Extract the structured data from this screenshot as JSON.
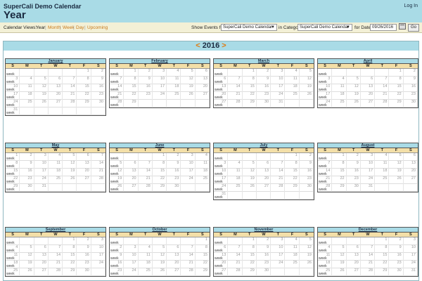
{
  "header": {
    "app_title": "SuperCali Demo Calendar",
    "page_title": "Year",
    "login": "Log In"
  },
  "toolbar": {
    "views_label": "Calendar Views:",
    "views": [
      "Year",
      "Month",
      "Week",
      "Day",
      "Upcoming"
    ],
    "show_events_label": "Show Events for:",
    "calendar_select": "SuperCali Demo Calendar",
    "category_label": "in Category:",
    "category_select": "SuperCali Demo Calendar",
    "date_label": "for Date:",
    "date_value": "09/26/2016",
    "go_label": "Go"
  },
  "year_nav": {
    "prev": "<",
    "year": "2016",
    "next": ">"
  },
  "weekdays": [
    "S",
    "M",
    "T",
    "W",
    "T",
    "F",
    "S"
  ],
  "week_label": "week",
  "months": [
    {
      "name": "January",
      "weeks": [
        [
          "",
          "",
          "",
          "",
          "",
          "1",
          "2"
        ],
        [
          "3",
          "4",
          "5",
          "6",
          "7",
          "8",
          "9"
        ],
        [
          "10",
          "11",
          "12",
          "13",
          "14",
          "15",
          "16"
        ],
        [
          "17",
          "18",
          "19",
          "20",
          "21",
          "22",
          "23"
        ],
        [
          "24",
          "25",
          "26",
          "27",
          "28",
          "29",
          "30"
        ],
        [
          "31",
          "",
          "",
          "",
          "",
          "",
          ""
        ]
      ]
    },
    {
      "name": "February",
      "weeks": [
        [
          "",
          "1",
          "2",
          "3",
          "4",
          "5",
          "6"
        ],
        [
          "7",
          "8",
          "9",
          "10",
          "11",
          "12",
          "13"
        ],
        [
          "14",
          "15",
          "16",
          "17",
          "18",
          "19",
          "20"
        ],
        [
          "21",
          "22",
          "23",
          "24",
          "25",
          "26",
          "27"
        ],
        [
          "28",
          "29",
          "",
          "",
          "",
          "",
          ""
        ]
      ]
    },
    {
      "name": "March",
      "weeks": [
        [
          "",
          "",
          "1",
          "2",
          "3",
          "4",
          "5"
        ],
        [
          "6",
          "7",
          "8",
          "9",
          "10",
          "11",
          "12"
        ],
        [
          "13",
          "14",
          "15",
          "16",
          "17",
          "18",
          "19"
        ],
        [
          "20",
          "21",
          "22",
          "23",
          "24",
          "25",
          "26"
        ],
        [
          "27",
          "28",
          "29",
          "30",
          "31",
          "",
          ""
        ]
      ]
    },
    {
      "name": "April",
      "weeks": [
        [
          "",
          "",
          "",
          "",
          "",
          "1",
          "2"
        ],
        [
          "3",
          "4",
          "5",
          "6",
          "7",
          "8",
          "9"
        ],
        [
          "10",
          "11",
          "12",
          "13",
          "14",
          "15",
          "16"
        ],
        [
          "17",
          "18",
          "19",
          "20",
          "21",
          "22",
          "23"
        ],
        [
          "24",
          "25",
          "26",
          "27",
          "28",
          "29",
          "30"
        ]
      ]
    },
    {
      "name": "May",
      "weeks": [
        [
          "1",
          "2",
          "3",
          "4",
          "5",
          "6",
          "7"
        ],
        [
          "8",
          "9",
          "10",
          "11",
          "12",
          "13",
          "14"
        ],
        [
          "15",
          "16",
          "17",
          "18",
          "19",
          "20",
          "21"
        ],
        [
          "22",
          "23",
          "24",
          "25",
          "26",
          "27",
          "28"
        ],
        [
          "29",
          "30",
          "31",
          "",
          "",
          "",
          ""
        ]
      ]
    },
    {
      "name": "June",
      "weeks": [
        [
          "",
          "",
          "",
          "1",
          "2",
          "3",
          "4"
        ],
        [
          "5",
          "6",
          "7",
          "8",
          "9",
          "10",
          "11"
        ],
        [
          "12",
          "13",
          "14",
          "15",
          "16",
          "17",
          "18"
        ],
        [
          "19",
          "20",
          "21",
          "22",
          "23",
          "24",
          "25"
        ],
        [
          "26",
          "27",
          "28",
          "29",
          "30",
          "",
          ""
        ]
      ]
    },
    {
      "name": "July",
      "weeks": [
        [
          "",
          "",
          "",
          "",
          "",
          "1",
          "2"
        ],
        [
          "3",
          "4",
          "5",
          "6",
          "7",
          "8",
          "9"
        ],
        [
          "10",
          "11",
          "12",
          "13",
          "14",
          "15",
          "16"
        ],
        [
          "17",
          "18",
          "19",
          "20",
          "21",
          "22",
          "23"
        ],
        [
          "24",
          "25",
          "26",
          "27",
          "28",
          "29",
          "30"
        ],
        [
          "31",
          "",
          "",
          "",
          "",
          "",
          ""
        ]
      ]
    },
    {
      "name": "August",
      "weeks": [
        [
          "",
          "1",
          "2",
          "3",
          "4",
          "5",
          "6"
        ],
        [
          "7",
          "8",
          "9",
          "10",
          "11",
          "12",
          "13"
        ],
        [
          "14",
          "15",
          "16",
          "17",
          "18",
          "19",
          "20"
        ],
        [
          "21",
          "22",
          "23",
          "24",
          "25",
          "26",
          "27"
        ],
        [
          "28",
          "29",
          "30",
          "31",
          "",
          "",
          ""
        ]
      ]
    },
    {
      "name": "September",
      "weeks": [
        [
          "",
          "",
          "",
          "",
          "1",
          "2",
          "3"
        ],
        [
          "4",
          "5",
          "6",
          "7",
          "8",
          "9",
          "10"
        ],
        [
          "11",
          "12",
          "13",
          "14",
          "15",
          "16",
          "17"
        ],
        [
          "18",
          "19",
          "20",
          "21",
          "22",
          "23",
          "24"
        ],
        [
          "25",
          "26",
          "27",
          "28",
          "29",
          "30",
          ""
        ]
      ]
    },
    {
      "name": "October",
      "weeks": [
        [
          "",
          "",
          "",
          "",
          "",
          "",
          "1"
        ],
        [
          "2",
          "3",
          "4",
          "5",
          "6",
          "7",
          "8"
        ],
        [
          "9",
          "10",
          "11",
          "12",
          "13",
          "14",
          "15"
        ],
        [
          "16",
          "17",
          "18",
          "19",
          "20",
          "21",
          "22"
        ],
        [
          "23",
          "24",
          "25",
          "26",
          "27",
          "28",
          "29"
        ]
      ]
    },
    {
      "name": "November",
      "weeks": [
        [
          "",
          "",
          "1",
          "2",
          "3",
          "4",
          "5"
        ],
        [
          "6",
          "7",
          "8",
          "9",
          "10",
          "11",
          "12"
        ],
        [
          "13",
          "14",
          "15",
          "16",
          "17",
          "18",
          "19"
        ],
        [
          "20",
          "21",
          "22",
          "23",
          "24",
          "25",
          "26"
        ],
        [
          "27",
          "28",
          "29",
          "30",
          "",
          "",
          ""
        ]
      ]
    },
    {
      "name": "December",
      "weeks": [
        [
          "",
          "",
          "",
          "",
          "1",
          "2",
          "3"
        ],
        [
          "4",
          "5",
          "6",
          "7",
          "8",
          "9",
          "10"
        ],
        [
          "11",
          "12",
          "13",
          "14",
          "15",
          "16",
          "17"
        ],
        [
          "18",
          "19",
          "20",
          "21",
          "22",
          "23",
          "24"
        ],
        [
          "25",
          "26",
          "27",
          "28",
          "29",
          "30",
          "31"
        ]
      ]
    }
  ]
}
